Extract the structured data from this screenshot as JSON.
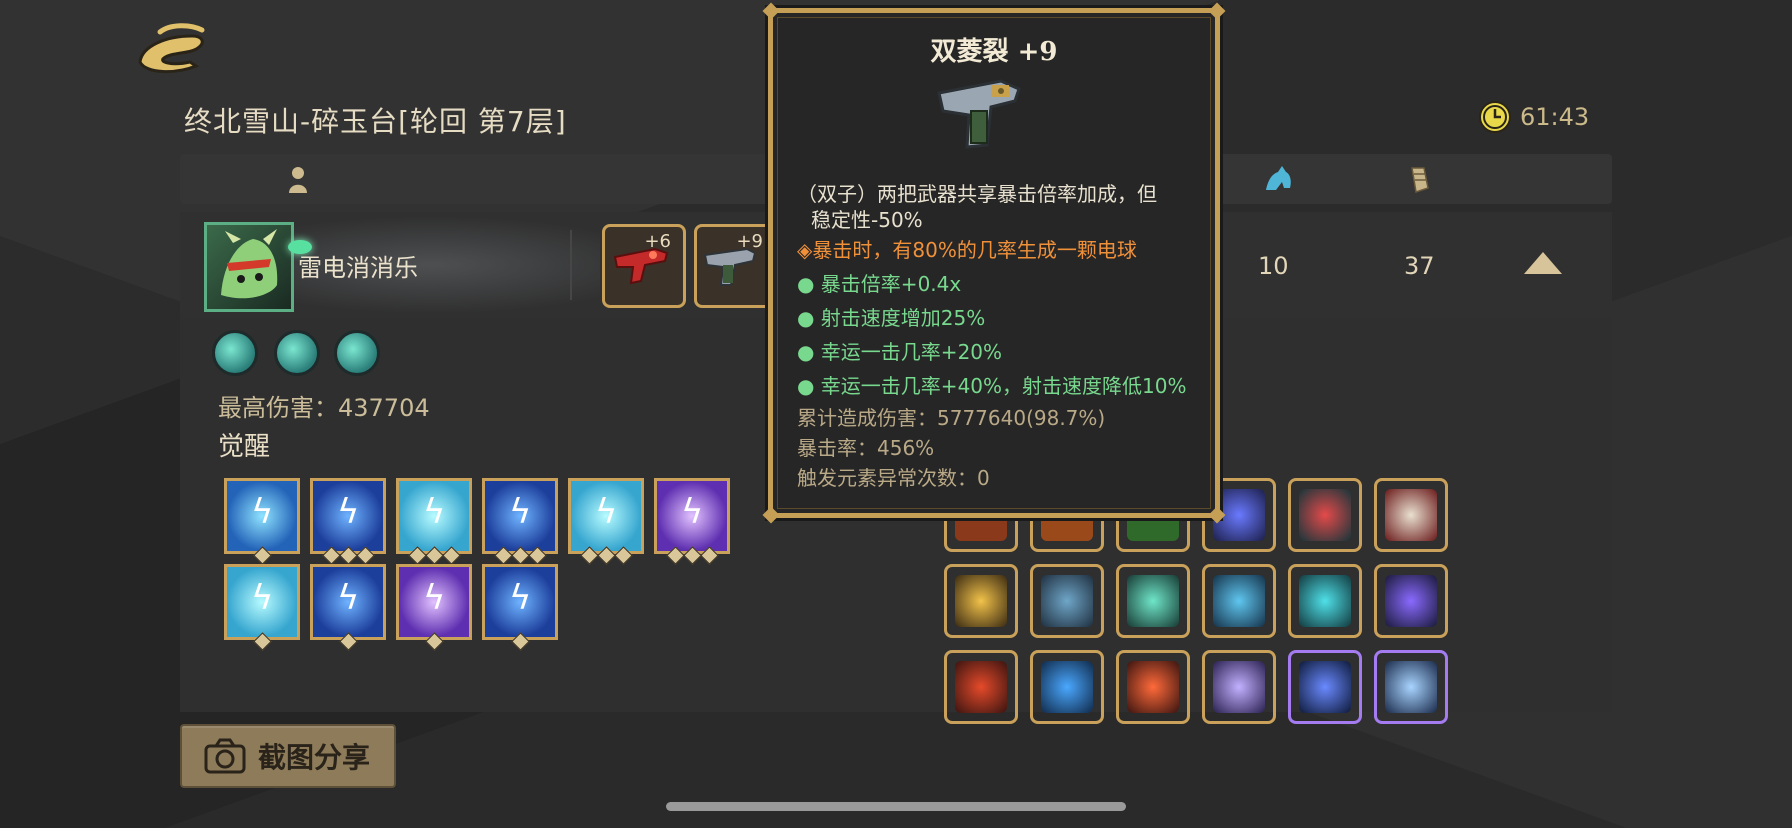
{
  "stage": {
    "title": "终北雪山-碎玉台[轮回 第7层]"
  },
  "timer": {
    "value": "61:43"
  },
  "player": {
    "name": "雷电消消乐",
    "weapons": [
      {
        "level": "+6"
      },
      {
        "level": "+9"
      }
    ],
    "stats": {
      "stat_a": "10",
      "stat_b": "37"
    }
  },
  "detail": {
    "max_damage_label": "最高伤害：437704",
    "awaken_title": "觉醒"
  },
  "share": {
    "label": "截图分享"
  },
  "tooltip": {
    "title": "双菱裂 +9",
    "lines": {
      "l1": "（双子）两把武器共享暴击倍率加成，但",
      "l1b": "稳定性-50%",
      "l2": "◈暴击时，有80%的几率生成一颗电球",
      "l3": "● 暴击倍率+0.4x",
      "l4": "● 射击速度增加25%",
      "l5": "● 幸运一击几率+20%",
      "l6": "● 幸运一击几率+40%，射击速度降低10%",
      "l7": "累计造成伤害：5777640(98.7%)",
      "l8": "暴击率：456%",
      "l9": "触发元素异常次数：0"
    }
  },
  "colors": {
    "accent_gold": "#c49f55",
    "effect_orange": "#f0913a",
    "effect_green": "#78d88e"
  }
}
